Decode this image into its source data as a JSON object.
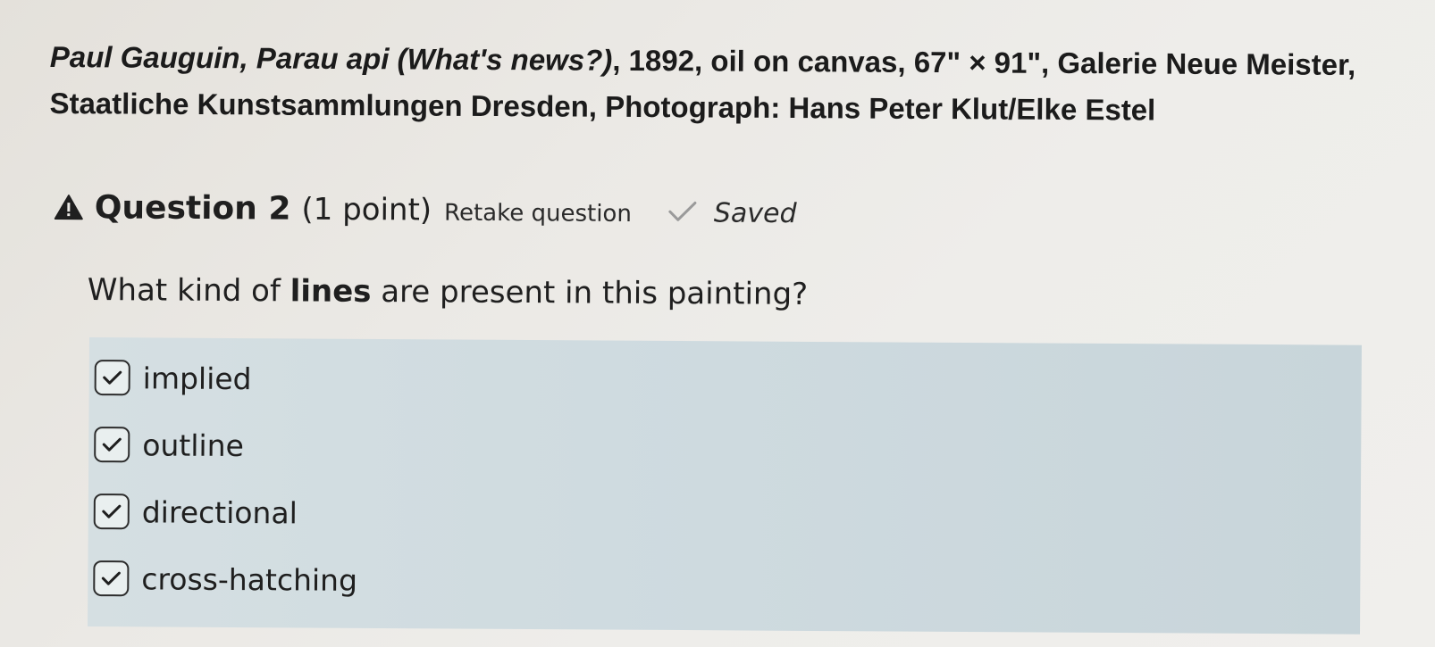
{
  "caption": {
    "line1_artist": "Paul Gauguin, ",
    "line1_title": "Parau api (What's news?)",
    "line1_rest": ", 1892, oil on canvas, 67\" × 91\", Galerie Neue Meister,",
    "line2": "Staatliche Kunstsammlungen Dresden, Photograph: Hans Peter Klut/Elke Estel"
  },
  "question": {
    "title": "Question 2",
    "points": "(1 point)",
    "retake_label": "Retake question",
    "saved_label": "Saved",
    "prompt_before": "What kind of ",
    "prompt_bold": "lines",
    "prompt_after": " are present in this painting?"
  },
  "options": [
    {
      "label": "implied",
      "checked": true
    },
    {
      "label": "outline",
      "checked": true
    },
    {
      "label": "directional",
      "checked": true
    },
    {
      "label": "cross-hatching",
      "checked": true
    }
  ],
  "icons": {
    "warning": "warning-icon",
    "saved": "checkmark-icon",
    "checkbox": "checkbox-checked-icon"
  },
  "colors": {
    "answer_bg": "#cfdbe0",
    "page_bg": "#ebe9e5",
    "text": "#1f1f1f",
    "saved_check": "#9a9a9a"
  }
}
